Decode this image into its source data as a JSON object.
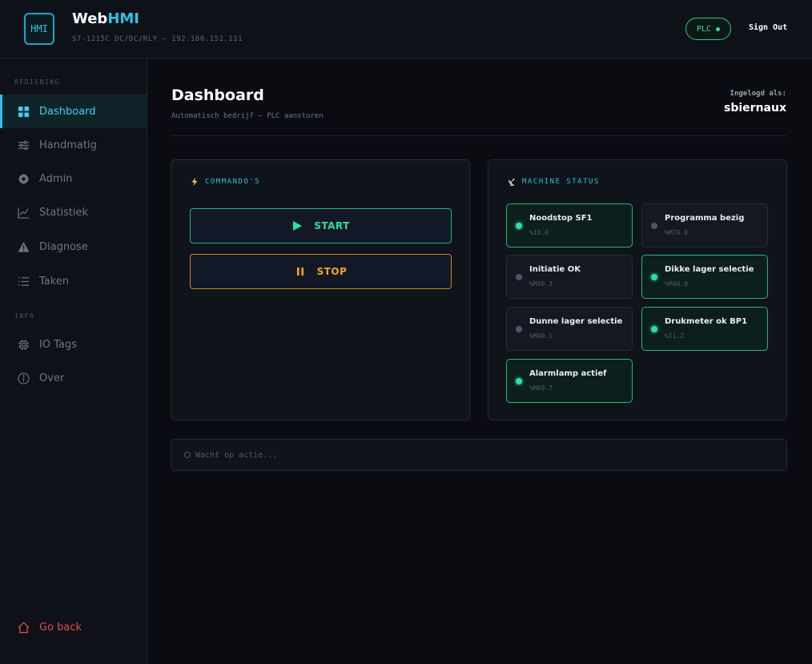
{
  "header": {
    "brand_a": "Web",
    "brand_b": "HMI",
    "logo_text": "HMI",
    "subtitle": "S7-1215C DC/DC/RLY — 192.168.152.111",
    "plc_label": "PLC",
    "signout_label": "Sign Out"
  },
  "sidebar": {
    "section_bediening": "BEDIENING",
    "section_info": "INFO",
    "items": [
      {
        "label": "Dashboard",
        "icon": "grid-icon",
        "active": true
      },
      {
        "label": "Handmatig",
        "icon": "sliders-icon"
      },
      {
        "label": "Admin",
        "icon": "gear-icon"
      },
      {
        "label": "Statistiek",
        "icon": "chart-line-icon"
      },
      {
        "label": "Diagnose",
        "icon": "warning-icon"
      },
      {
        "label": "Taken",
        "icon": "list-icon"
      },
      {
        "label": "IO Tags",
        "icon": "chip-icon"
      },
      {
        "label": "Over",
        "icon": "info-icon"
      }
    ],
    "goback_label": "Go back"
  },
  "main": {
    "title": "Dashboard",
    "subtitle": "Automatisch bedrijf — PLC aansturen",
    "logged_label": "Ingelogd als:",
    "logged_user": "sbiernaux"
  },
  "commands": {
    "title": "COMMANDO'S",
    "start_label": "START",
    "stop_label": "STOP"
  },
  "machine_status": {
    "title": "MACHINE STATUS",
    "items": [
      {
        "name": "Noodstop SF1",
        "tag": "%I0.0",
        "on": true
      },
      {
        "name": "Programma bezig",
        "tag": "%M70.0",
        "on": false
      },
      {
        "name": "Initiatie OK",
        "tag": "%M40.3",
        "on": false
      },
      {
        "name": "Dikke lager selectie",
        "tag": "%M40.0",
        "on": true
      },
      {
        "name": "Dunne lager selectie",
        "tag": "%M40.1",
        "on": false
      },
      {
        "name": "Drukmeter ok BP1",
        "tag": "%I1.2",
        "on": true
      },
      {
        "name": "Alarmlamp actief",
        "tag": "%M69.7",
        "on": true
      }
    ]
  },
  "log": {
    "message": "Wacht op actie..."
  },
  "colors": {
    "accent": "#2cc3e6",
    "success": "#2fe0a0",
    "warning": "#f2a81c",
    "danger": "#e34b4b"
  }
}
